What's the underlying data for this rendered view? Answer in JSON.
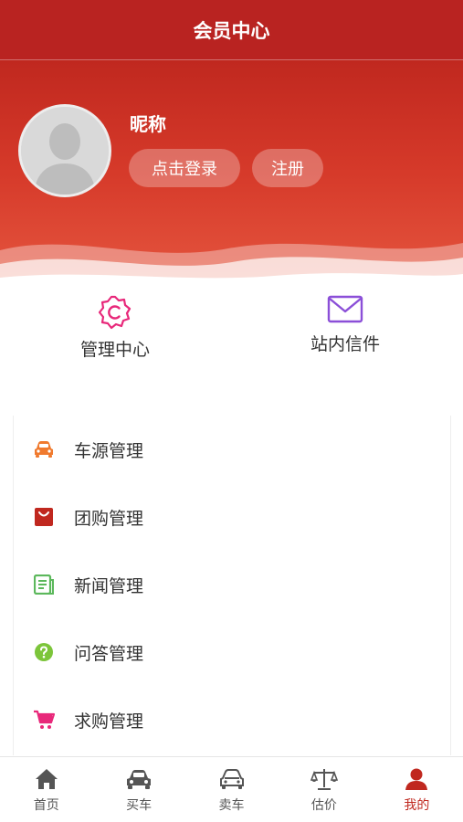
{
  "header": {
    "title": "会员中心"
  },
  "profile": {
    "nickname": "昵称",
    "login_label": "点击登录",
    "register_label": "注册"
  },
  "quick_links": [
    {
      "label": "管理中心",
      "icon": "admin-center-icon"
    },
    {
      "label": "站内信件",
      "icon": "mail-icon"
    }
  ],
  "menu": [
    {
      "label": "车源管理",
      "icon": "car-icon",
      "color": "#f07a2e"
    },
    {
      "label": "团购管理",
      "icon": "bag-icon",
      "color": "#c0281f"
    },
    {
      "label": "新闻管理",
      "icon": "news-icon",
      "color": "#5cb85c"
    },
    {
      "label": "问答管理",
      "icon": "question-icon",
      "color": "#7cc53a"
    },
    {
      "label": "求购管理",
      "icon": "cart-icon",
      "color": "#e8287a"
    }
  ],
  "tabbar": [
    {
      "label": "首页",
      "icon": "home-icon",
      "active": false
    },
    {
      "label": "买车",
      "icon": "car-buy-icon",
      "active": false
    },
    {
      "label": "卖车",
      "icon": "car-sell-icon",
      "active": false
    },
    {
      "label": "估价",
      "icon": "scale-icon",
      "active": false
    },
    {
      "label": "我的",
      "icon": "user-icon",
      "active": true
    }
  ],
  "colors": {
    "brand": "#c0281f",
    "text": "#333333"
  }
}
